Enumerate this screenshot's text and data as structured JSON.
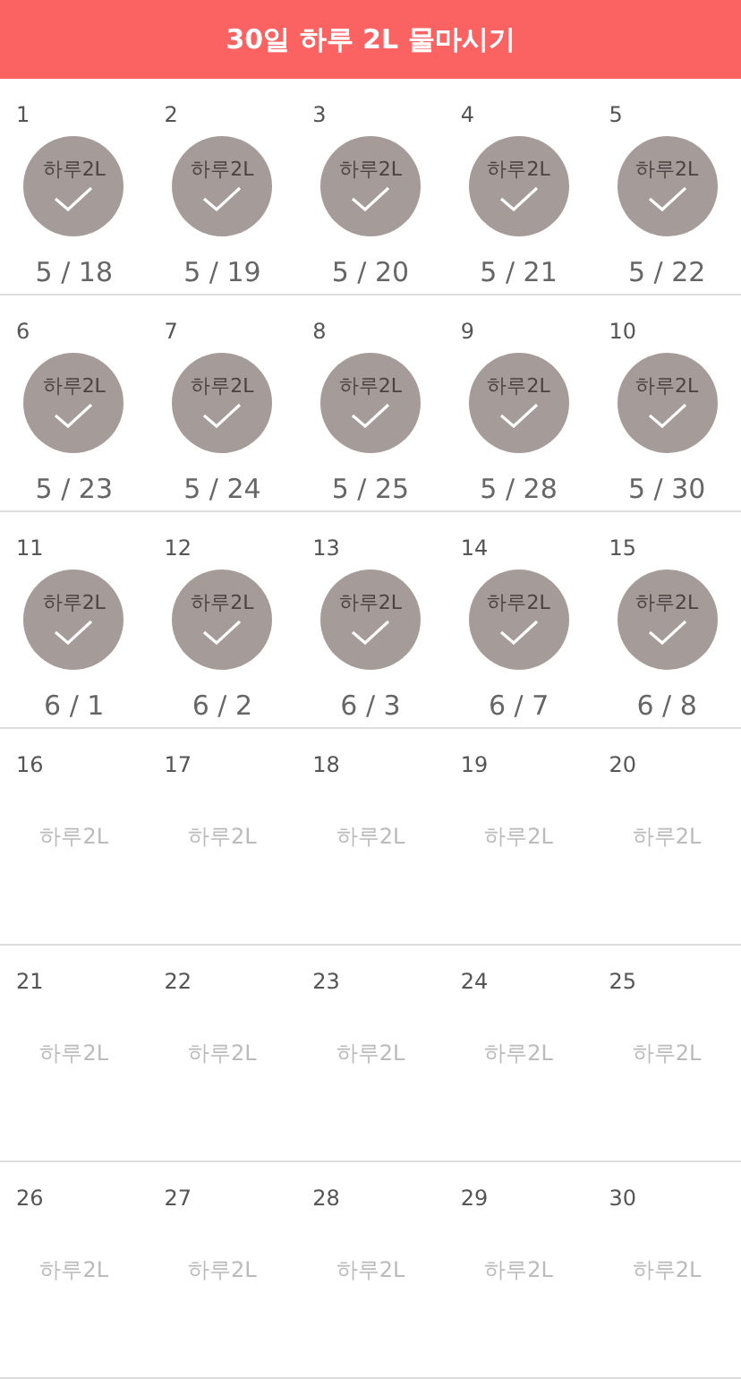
{
  "header": {
    "title": "30일 하루 2L 물마시기"
  },
  "days": [
    {
      "day": "1",
      "done": true,
      "label": "하루2L",
      "date": "5 / 18"
    },
    {
      "day": "2",
      "done": true,
      "label": "하루2L",
      "date": "5 / 19"
    },
    {
      "day": "3",
      "done": true,
      "label": "하루2L",
      "date": "5 / 20"
    },
    {
      "day": "4",
      "done": true,
      "label": "하루2L",
      "date": "5 / 21"
    },
    {
      "day": "5",
      "done": true,
      "label": "하루2L",
      "date": "5 / 22"
    },
    {
      "day": "6",
      "done": true,
      "label": "하루2L",
      "date": "5 / 23"
    },
    {
      "day": "7",
      "done": true,
      "label": "하루2L",
      "date": "5 / 24"
    },
    {
      "day": "8",
      "done": true,
      "label": "하루2L",
      "date": "5 / 25"
    },
    {
      "day": "9",
      "done": true,
      "label": "하루2L",
      "date": "5 / 28"
    },
    {
      "day": "10",
      "done": true,
      "label": "하루2L",
      "date": "5 / 30"
    },
    {
      "day": "11",
      "done": true,
      "label": "하루2L",
      "date": "6 / 1"
    },
    {
      "day": "12",
      "done": true,
      "label": "하루2L",
      "date": "6 / 2"
    },
    {
      "day": "13",
      "done": true,
      "label": "하루2L",
      "date": "6 / 3"
    },
    {
      "day": "14",
      "done": true,
      "label": "하루2L",
      "date": "6 / 7"
    },
    {
      "day": "15",
      "done": true,
      "label": "하루2L",
      "date": "6 / 8"
    },
    {
      "day": "16",
      "done": false,
      "label": "하루2L"
    },
    {
      "day": "17",
      "done": false,
      "label": "하루2L"
    },
    {
      "day": "18",
      "done": false,
      "label": "하루2L"
    },
    {
      "day": "19",
      "done": false,
      "label": "하루2L"
    },
    {
      "day": "20",
      "done": false,
      "label": "하루2L"
    },
    {
      "day": "21",
      "done": false,
      "label": "하루2L"
    },
    {
      "day": "22",
      "done": false,
      "label": "하루2L"
    },
    {
      "day": "23",
      "done": false,
      "label": "하루2L"
    },
    {
      "day": "24",
      "done": false,
      "label": "하루2L"
    },
    {
      "day": "25",
      "done": false,
      "label": "하루2L"
    },
    {
      "day": "26",
      "done": false,
      "label": "하루2L"
    },
    {
      "day": "27",
      "done": false,
      "label": "하루2L"
    },
    {
      "day": "28",
      "done": false,
      "label": "하루2L"
    },
    {
      "day": "29",
      "done": false,
      "label": "하루2L"
    },
    {
      "day": "30",
      "done": false,
      "label": "하루2L"
    }
  ]
}
